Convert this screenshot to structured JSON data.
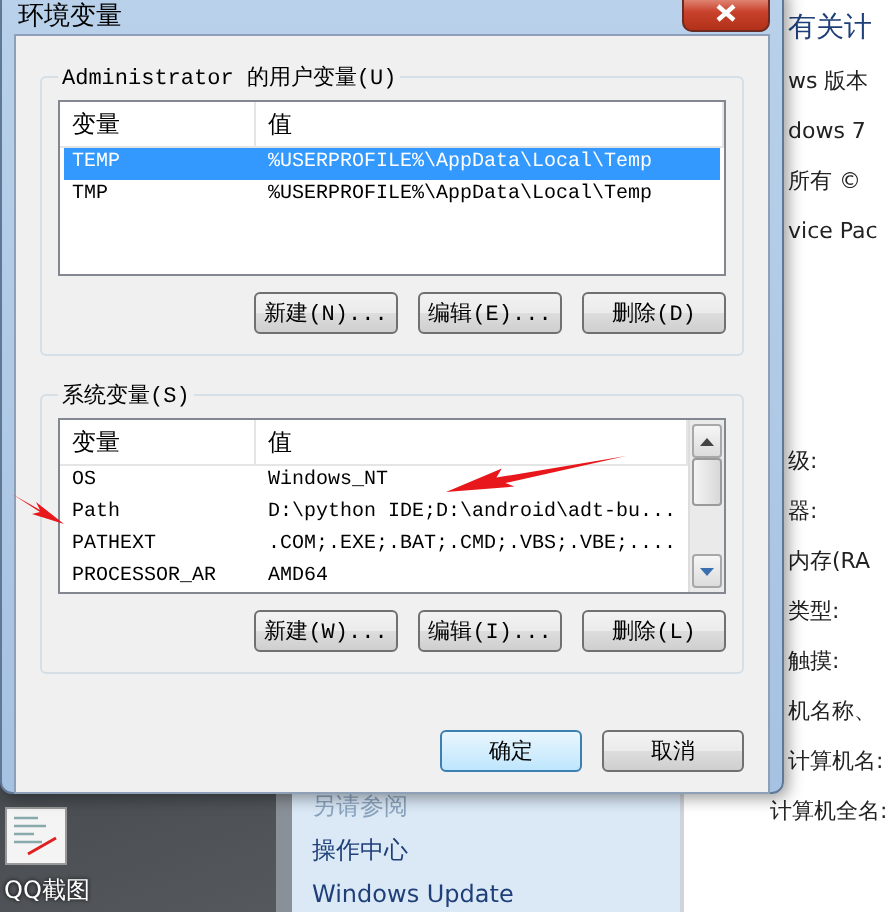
{
  "dialog": {
    "title": "环境变量",
    "user_group": {
      "label": "Administrator 的用户变量(U)",
      "columns": [
        "变量",
        "值"
      ],
      "rows": [
        {
          "name": "TEMP",
          "value": "%USERPROFILE%\\AppData\\Local\\Temp",
          "selected": true
        },
        {
          "name": "TMP",
          "value": "%USERPROFILE%\\AppData\\Local\\Temp",
          "selected": false
        }
      ],
      "buttons": [
        "新建(N)...",
        "编辑(E)...",
        "删除(D)"
      ]
    },
    "system_group": {
      "label": "系统变量(S)",
      "columns": [
        "变量",
        "值"
      ],
      "rows": [
        {
          "name": "OS",
          "value": "Windows_NT",
          "selected": false
        },
        {
          "name": "Path",
          "value": "D:\\python IDE;D:\\android\\adt-bu...",
          "selected": false
        },
        {
          "name": "PATHEXT",
          "value": ".COM;.EXE;.BAT;.CMD;.VBS;.VBE;....",
          "selected": false
        },
        {
          "name": "PROCESSOR_AR",
          "value": "AMD64",
          "selected": false
        }
      ],
      "buttons": [
        "新建(W)...",
        "编辑(I)...",
        "删除(L)"
      ]
    },
    "footer_buttons": [
      {
        "label": "确定",
        "default": true
      },
      {
        "label": "取消",
        "default": false
      }
    ]
  },
  "background": {
    "right_panel": [
      {
        "text": "有关计",
        "kind": "heading"
      },
      {
        "text": "ws 版本",
        "kind": "line"
      },
      {
        "text": "dows 7",
        "kind": "line"
      },
      {
        "text": "所有 ©",
        "kind": "line"
      },
      {
        "text": "vice Pac",
        "kind": "line"
      },
      {
        "text": "级:",
        "kind": "gap"
      },
      {
        "text": "器:",
        "kind": "line"
      },
      {
        "text": "内存(RA",
        "kind": "line"
      },
      {
        "text": "类型:",
        "kind": "line"
      },
      {
        "text": "触摸:",
        "kind": "line"
      },
      {
        "text": "机名称、",
        "kind": "line"
      },
      {
        "text": "计算机名:",
        "kind": "line"
      },
      {
        "text": "计算机全名:",
        "kind": "below"
      }
    ],
    "left_pane": [
      "另请参阅",
      "操作中心",
      "Windows Update"
    ],
    "desktop_icon": {
      "label": "QQ截图"
    }
  }
}
